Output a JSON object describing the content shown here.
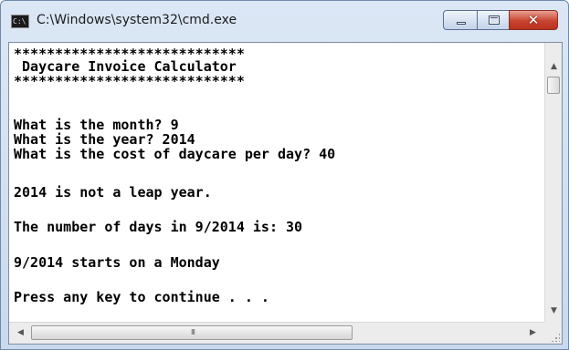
{
  "window": {
    "title": "C:\\Windows\\system32\\cmd.exe",
    "icon": "cmd-icon",
    "icon_text": "C:\\",
    "buttons": {
      "minimize_icon": "minimize-icon",
      "maximize_icon": "maximize-icon",
      "close_icon": "close-icon",
      "close_glyph": "✕"
    }
  },
  "console": {
    "lines": [
      "****************************",
      " Daycare Invoice Calculator",
      "****************************",
      "",
      "What is the month? 9",
      "What is the year? 2014",
      "What is the cost of daycare per day? 40",
      "",
      "2014 is not a leap year.",
      "",
      "The number of days in 9/2014 is: 30",
      "",
      "9/2014 starts on a Monday",
      "",
      "Press any key to continue . . ."
    ]
  },
  "scrollbars": {
    "up_arrow": "▲",
    "down_arrow": "▼",
    "left_arrow": "◀",
    "right_arrow": "▶",
    "grip": "III"
  },
  "colors": {
    "console_background": "#ffffff",
    "console_text": "#000000",
    "close_button": "#c9432f",
    "title_bar": "#dbe7f5"
  }
}
